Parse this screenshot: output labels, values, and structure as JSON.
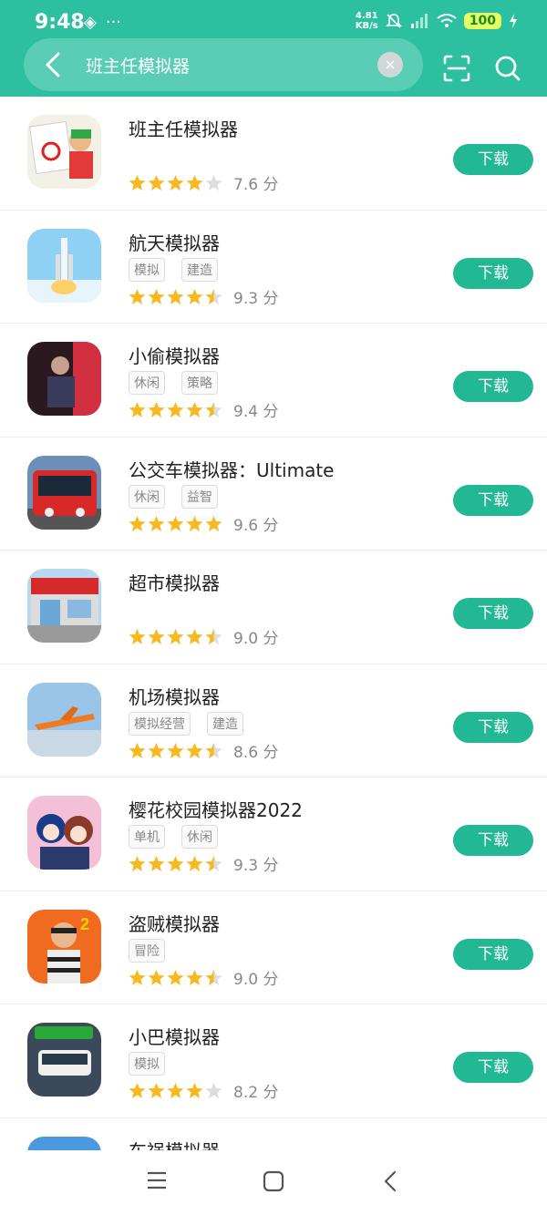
{
  "status": {
    "time": "9:48",
    "net_speed_value": "4.81",
    "net_speed_unit": "KB/s",
    "battery": "100",
    "left_icons": [
      "nav-diamond-icon",
      "more-dots-icon"
    ],
    "right_icons": [
      "bell-off-icon",
      "signal-icon",
      "wifi-icon",
      "charging-icon"
    ]
  },
  "search": {
    "query": "班主任模拟器",
    "clear_label": "×"
  },
  "apps": [
    {
      "name": "班主任模拟器",
      "tags": [],
      "rating": 7.6,
      "score_text": "7.6 分",
      "stars": [
        1,
        1,
        1,
        1,
        0
      ],
      "download": "下载",
      "icon_theme": "teacher"
    },
    {
      "name": "航天模拟器",
      "tags": [
        "模拟",
        "建造"
      ],
      "rating": 9.3,
      "score_text": "9.3 分",
      "stars": [
        1,
        1,
        1,
        1,
        0.5
      ],
      "download": "下载",
      "icon_theme": "rocket"
    },
    {
      "name": "小偷模拟器",
      "tags": [
        "休闲",
        "策略"
      ],
      "rating": 9.4,
      "score_text": "9.4 分",
      "stars": [
        1,
        1,
        1,
        1,
        0.5
      ],
      "download": "下载",
      "icon_theme": "thief-dark"
    },
    {
      "name": "公交车模拟器：Ultimate",
      "tags": [
        "休闲",
        "益智"
      ],
      "rating": 9.6,
      "score_text": "9.6 分",
      "stars": [
        1,
        1,
        1,
        1,
        1
      ],
      "download": "下载",
      "icon_theme": "bus"
    },
    {
      "name": "超市模拟器",
      "tags": [],
      "rating": 9.0,
      "score_text": "9.0 分",
      "stars": [
        1,
        1,
        1,
        1,
        0.5
      ],
      "download": "下载",
      "icon_theme": "supermarket"
    },
    {
      "name": "机场模拟器",
      "tags": [
        "模拟经营",
        "建造"
      ],
      "rating": 8.6,
      "score_text": "8.6 分",
      "stars": [
        1,
        1,
        1,
        1,
        0.5
      ],
      "download": "下载",
      "icon_theme": "airport"
    },
    {
      "name": "樱花校园模拟器2022",
      "tags": [
        "单机",
        "休闲"
      ],
      "rating": 9.3,
      "score_text": "9.3 分",
      "stars": [
        1,
        1,
        1,
        1,
        0.5
      ],
      "download": "下载",
      "icon_theme": "anime"
    },
    {
      "name": "盗贼模拟器",
      "tags": [
        "冒险"
      ],
      "rating": 9.0,
      "score_text": "9.0 分",
      "stars": [
        1,
        1,
        1,
        1,
        0.5
      ],
      "download": "下载",
      "icon_theme": "robber"
    },
    {
      "name": "小巴模拟器",
      "tags": [
        "模拟"
      ],
      "rating": 8.2,
      "score_text": "8.2 分",
      "stars": [
        1,
        1,
        1,
        1,
        0
      ],
      "download": "下载",
      "icon_theme": "minibus"
    },
    {
      "name": "车祸模拟器",
      "tags": [],
      "rating": null,
      "score_text": "",
      "stars": [],
      "download": "",
      "icon_theme": "sky"
    }
  ],
  "colors": {
    "header": "#2cc0a0",
    "button": "#22b894",
    "star_on": "#f7b820",
    "star_off": "#dddddd"
  }
}
